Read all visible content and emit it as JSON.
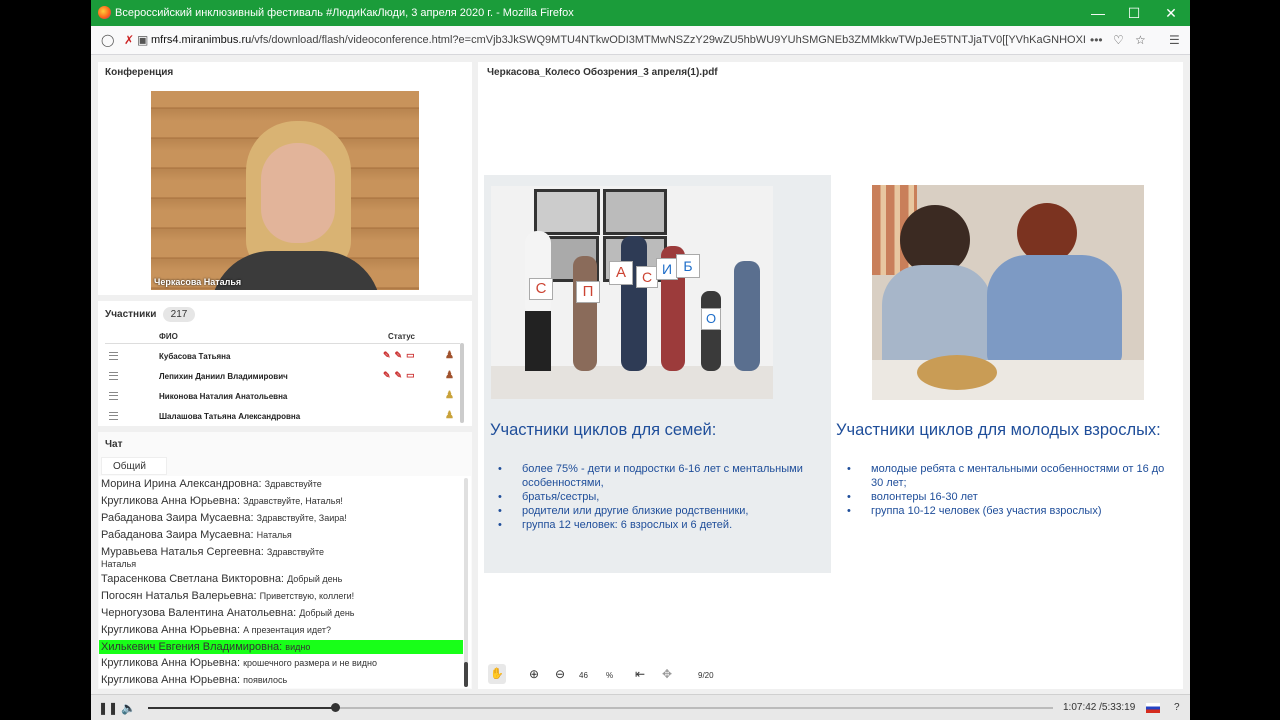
{
  "window": {
    "title": "Всероссийский инклюзивный фестиваль #ЛюдиКакЛюди, 3 апреля 2020 г. - Mozilla Firefox"
  },
  "urlbar": {
    "domain": "mfrs4.miranimbus.ru",
    "url_rest": "/vfs/download/flash/videoconference.html?e=cmVjb3JkSWQ9MTU4NTkwODI3MTMwNSZzY29wZU5hbWU9YUhSMGNEb3ZMMkkwTWpJeE5TNTJjaTV0[[YVhKaGNHOXI",
    "more": "•••"
  },
  "conference": {
    "title": "Конференция",
    "speaker_name": "Черкасова Наталья"
  },
  "participants": {
    "title": "Участники",
    "count": "217",
    "col_name": "ФИО",
    "col_status": "Статус",
    "rows": [
      {
        "name": "Кубасова Татьяна",
        "status": "✎✎▭"
      },
      {
        "name": "Лепихин Даниил Владимирович",
        "status": "✎✎▭"
      },
      {
        "name": "Никонова Наталия Анатольевна",
        "status": ""
      },
      {
        "name": "Шалашова Татьяна Александровна",
        "status": ""
      }
    ]
  },
  "chat": {
    "title": "Чат",
    "tab": "Общий",
    "messages": [
      {
        "author": "Морина Ирина Александровна:",
        "text": "Здравствуйте"
      },
      {
        "author": "Кругликова Анна Юрьевна:",
        "text": "Здравствуйте, Наталья!"
      },
      {
        "author": "Рабаданова Заира Мусаевна:",
        "text": "Здравствуйте, Заира!"
      },
      {
        "author": "Рабаданова Заира Мусаевна:",
        "text": "Наталья"
      },
      {
        "author": "Муравьева Наталья Сергеевна:",
        "text": "Здравствуйте Наталья"
      },
      {
        "author": "Тарасенкова Светлана Викторовна:",
        "text": "Добрый день"
      },
      {
        "author": "Погосян Наталья Валерьевна:",
        "text": "Приветствую, коллеги!"
      },
      {
        "author": "Черногузова Валентина Анатольевна:",
        "text": "Добрый день"
      },
      {
        "author": "Кругликова Анна Юрьевна:",
        "text": "А презентация идет?"
      },
      {
        "author": "Хилькевич Евгения Владимировна:",
        "text": "видно",
        "highlight": true
      },
      {
        "author": "Кругликова Анна Юрьевна:",
        "text": "крошечного размера и не видно"
      },
      {
        "author": "Кругликова Анна Юрьевна:",
        "text": "появилось"
      }
    ]
  },
  "document": {
    "title": "Черкасова_Колесо Обозрения_3 апреля(1).pdf",
    "slide": {
      "left_heading": "Участники циклов для семей:",
      "left_bullets": [
        "более 75% - дети  и подростки 6-16 лет с ментальными особенностями,",
        " братья/сестры,",
        "родители или другие близкие родственники,",
        "группа 12 человек: 6 взрослых и 6 детей."
      ],
      "right_heading": "Участники циклов для молодых взрослых:",
      "right_bullets": [
        "молодые ребята с ментальными особенностями от 16 до 30 лет;",
        "волонтеры 16-30 лет",
        "группа 10-12 человек (без участия взрослых)"
      ],
      "letters": [
        "С",
        "П",
        "А",
        "С",
        "И",
        "Б",
        "О"
      ]
    },
    "toolbar": {
      "zoom": "46",
      "zoom_unit": "%",
      "page": "9/20"
    }
  },
  "player": {
    "time": "1:07:42 /5:33:19",
    "progress": 0.207,
    "help": "?"
  }
}
